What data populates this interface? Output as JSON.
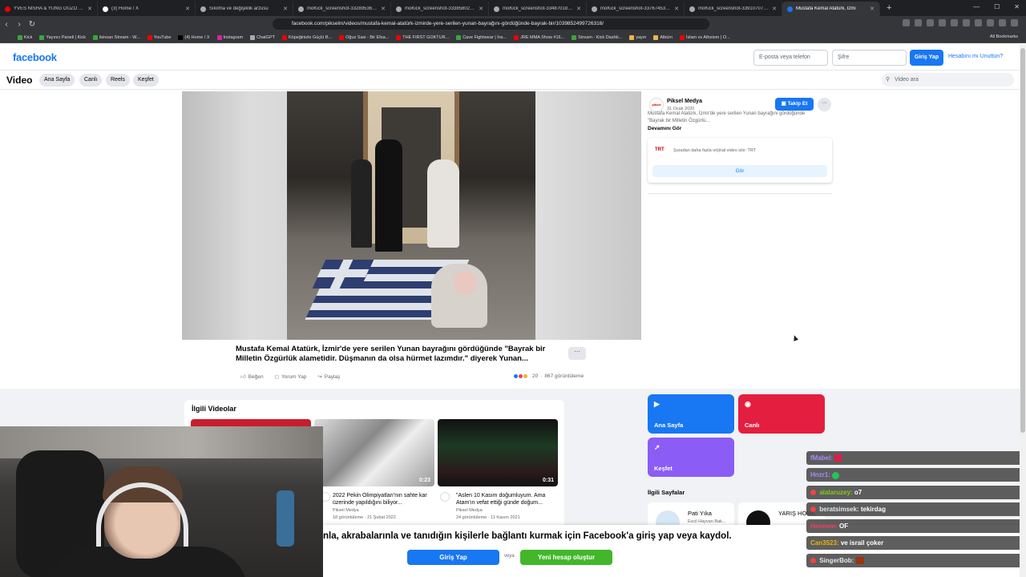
{
  "browser": {
    "tabs": [
      {
        "title": "YVES NISHA & YUNG OUZO - 20",
        "active": false
      },
      {
        "title": "(3) Home / X",
        "active": false
      },
      {
        "title": "Sıkılma ve değişiklik arzusu",
        "active": false
      },
      {
        "title": "moKick_screenshot-3328953604.png",
        "active": false
      },
      {
        "title": "moKick_screenshot-3338580219.png",
        "active": false
      },
      {
        "title": "moKick_screenshot-3348701844.png",
        "active": false
      },
      {
        "title": "moKick_screenshot-3376745364.png",
        "active": false
      },
      {
        "title": "moKick_screenshot-3391070705.png",
        "active": false
      },
      {
        "title": "Mustafa Kemal Atatürk, İzmi",
        "active": true
      }
    ],
    "url": "facebook.com/pikselm/videos/mustafa-kemal-atatürk-izmirde-yere-serilen-yunan-bayrağını-gördüğünde-bayrak-bir/1039852499726316/",
    "bookmarks": [
      "Kick",
      "Yayıncı Paneli | Kick",
      "ikinsan Stream - W...",
      "YouTube",
      "(4) Home / X",
      "Instagram",
      "ChatGPT",
      "Köpeğinizle Güçlü B...",
      "Oğuz Sasi - Bir Efsa...",
      "THE FIRST GOKTUR...",
      "Cave Fightwear | İns...",
      "JRE MMA Show #16...",
      "Stream - Kick Dashb...",
      "yayın",
      "Albüm",
      "İslam vs Atheism | O..."
    ],
    "all_bookmarks": "All Bookmarks"
  },
  "header": {
    "logo": "facebook",
    "email_placeholder": "E-posta veya telefon",
    "password_placeholder": "Şifre",
    "login": "Giriş Yap",
    "forgot": "Hesabını mı Unuttun?"
  },
  "subnav": {
    "title": "Video",
    "chips": [
      "Ana Sayfa",
      "Canlı",
      "Reels",
      "Keşfet"
    ],
    "search_placeholder": "Video ara"
  },
  "video": {
    "title": "Mustafa Kemal Atatürk, İzmir'de yere serilen Yunan bayrağını gördüğünde \"Bayrak bir Milletin Özgürlük alametidir. Düşmanın da olsa hürmet lazımdır.\" diyerek Yunan...",
    "actions": {
      "like": "Beğen",
      "comment": "Yorum Yap",
      "share": "Paylaş"
    },
    "reactions_count": "20",
    "views": "867 görüntüleme"
  },
  "page": {
    "name": "Piksel Medya",
    "date": "31 Ocak 2020",
    "follow": "Takip Et",
    "description": "Mustafa Kemal Atatürk, İzmir'de yere serilen Yunan bayrağını gördüğünde \"Bayrak bir Milletin Özgürlü...",
    "see_more": "Devamını Gör",
    "source_logo": "TRT",
    "source_text": "Şuradan daha fazla orijinal video izle: TRT",
    "see_button": "Gör"
  },
  "related": {
    "title": "İlgili Videolar",
    "videos": [
      {
        "duration": "",
        "title": "",
        "channel": "",
        "meta": ""
      },
      {
        "duration": "0:23",
        "title": "2022 Pekin Olimpiyatları'nın sahte kar üzerinde yapıldığını biliyor...",
        "channel": "Piksel Medya",
        "meta": "18 görüntüleme · 21 Şubat 2022"
      },
      {
        "duration": "0:31",
        "title": "\"Aslen 10 Kasım doğumluyum. Ama Atam'ın vefat ettiği günde doğum...",
        "channel": "Piksel Medya",
        "meta": "24 görüntüleme · 11 Kasım 2021"
      }
    ]
  },
  "tiles": {
    "home": "Ana Sayfa",
    "live": "Canlı",
    "explore": "Keşfet",
    "home_color": "#1877f2",
    "live_color": "#e41e3f",
    "explore_color": "#8b5cf6"
  },
  "related_pages": {
    "title": "İlgili Sayfalar",
    "cards": [
      {
        "name": "Pati Yıka",
        "sub": "Evcil Hayvan Bak..."
      },
      {
        "name": "YARIŞ HOME",
        "sub": ""
      }
    ]
  },
  "banner": {
    "text": "nla, akrabalarınla ve tanıdığın kişilerle bağlantı kurmak için Facebook'a giriş yap veya kaydol.",
    "login": "Giriş Yap",
    "or": "veya",
    "signup": "Yeni hesap oluştur"
  },
  "chat": [
    {
      "user": "fMabel:",
      "msg": "",
      "color": "#a78bfa",
      "emote_color": "#e11d48",
      "has_emote": true
    },
    {
      "user": "Hnzr1:",
      "msg": "",
      "color": "#a78bfa",
      "emote_color": "#22c55e",
      "has_emote": true
    },
    {
      "user": "alalaruzey:",
      "msg": "o7",
      "color": "#84cc16",
      "emote_color": "",
      "has_emote": false
    },
    {
      "user": "beratsimsek:",
      "msg": "tekirdag",
      "color": "#e5e7eb",
      "emote_color": "",
      "has_emote": false
    },
    {
      "user": "Haseom:",
      "msg": "OF",
      "color": "#f43f5e",
      "emote_color": "",
      "has_emote": false
    },
    {
      "user": "Can3523:",
      "msg": "ve israil çoker",
      "color": "#eab308",
      "emote_color": "",
      "has_emote": false
    },
    {
      "user": "SingerBob:",
      "msg": "",
      "color": "#e5e7eb",
      "emote_color": "#9a3412",
      "has_emote": true
    }
  ]
}
